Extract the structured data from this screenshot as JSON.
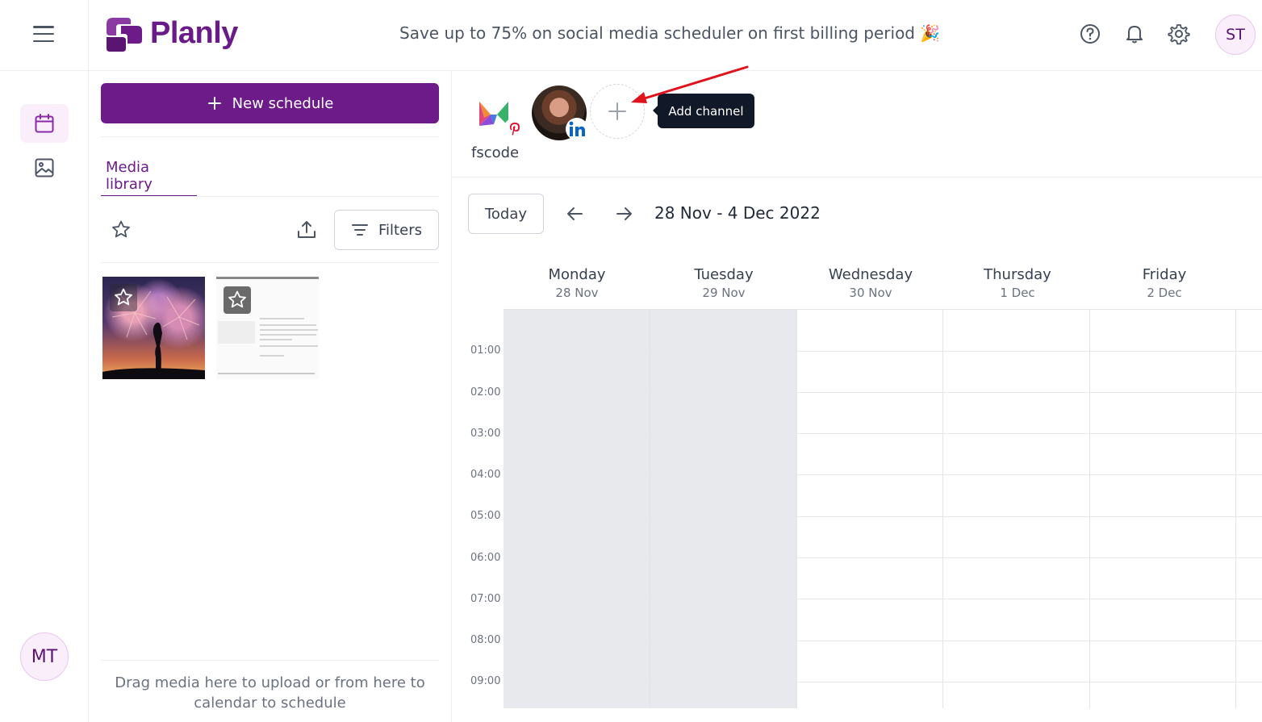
{
  "app": {
    "name": "Planly"
  },
  "header": {
    "promo": "Save up to 75% on social media scheduler on first billing period",
    "promo_emoji": "🎉",
    "user_initials": "ST",
    "icons": [
      "help-icon",
      "bell-icon",
      "gear-icon"
    ]
  },
  "rail": {
    "items": [
      "calendar-icon",
      "image-icon"
    ],
    "user_initials": "MT"
  },
  "media": {
    "new_schedule_label": "New schedule",
    "tab_label": "Media library",
    "filters_label": "Filters",
    "drag_hint": "Drag media here to upload or from here to calendar to schedule",
    "items": [
      {
        "kind": "fireworks-photo"
      },
      {
        "kind": "document-screenshot"
      }
    ]
  },
  "channels": {
    "name": "fscode",
    "items": [
      {
        "network": "pinterest"
      },
      {
        "network": "linkedin"
      }
    ],
    "add_tooltip": "Add channel"
  },
  "calendar": {
    "today_label": "Today",
    "range": "28 Nov - 4 Dec 2022",
    "days": [
      {
        "name": "Monday",
        "date": "28 Nov"
      },
      {
        "name": "Tuesday",
        "date": "29 Nov"
      },
      {
        "name": "Wednesday",
        "date": "30 Nov"
      },
      {
        "name": "Thursday",
        "date": "1 Dec"
      },
      {
        "name": "Friday",
        "date": "2 Dec"
      }
    ],
    "hours": [
      "01:00",
      "02:00",
      "03:00",
      "04:00",
      "05:00",
      "06:00",
      "07:00",
      "08:00",
      "09:00"
    ]
  },
  "colors": {
    "brand": "#6d1b89",
    "arrow": "#e0121b"
  }
}
